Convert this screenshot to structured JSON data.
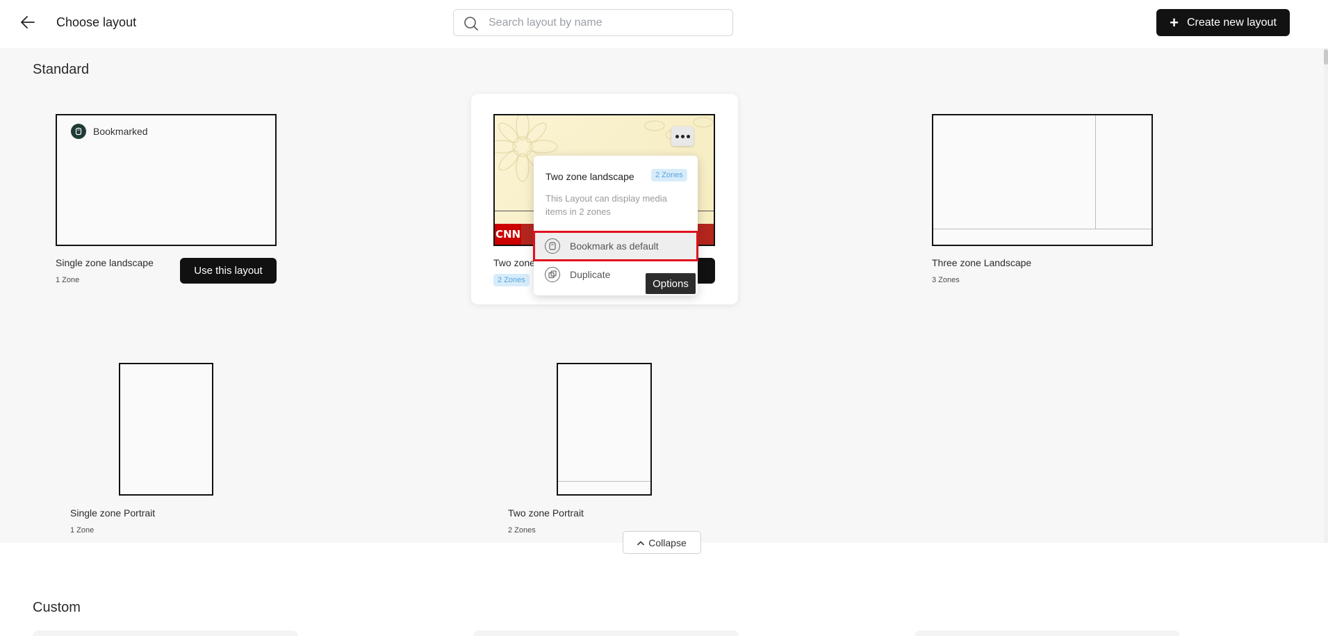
{
  "header": {
    "back_icon": "arrow-left-icon",
    "title": "Choose layout",
    "search_placeholder": "Search layout by name",
    "create_label": "Create new layout"
  },
  "standard": {
    "title": "Standard",
    "cards": [
      {
        "name": "Single zone landscape",
        "zones": "1 Zone",
        "bookmark_label": "Bookmarked",
        "button": "Use this layout"
      },
      {
        "name": "Two zone landscape",
        "name_visible": "Two zone",
        "zones": "2 Zones",
        "preview_logo": "CNN"
      },
      {
        "name": "Three zone Landscape",
        "zones": "3 Zones"
      },
      {
        "name": "Single zone Portrait",
        "zones": "1 Zone"
      },
      {
        "name": "Two zone Portrait",
        "zones": "2 Zones"
      }
    ],
    "collapse_label": "Collapse"
  },
  "popover": {
    "title": "Two zone landscape",
    "badge": "2 Zones",
    "description": "This Layout can display media items in 2 zones",
    "items": [
      {
        "label": "Bookmark as default",
        "icon": "bookmark-icon"
      },
      {
        "label": "Duplicate",
        "icon": "duplicate-icon"
      }
    ],
    "tooltip": "Options"
  },
  "custom": {
    "title": "Custom"
  },
  "colors": {
    "primary": "#121212",
    "highlight": "#e0101e",
    "badge_bg": "#d7ecfb",
    "badge_text": "#5aa4db"
  }
}
